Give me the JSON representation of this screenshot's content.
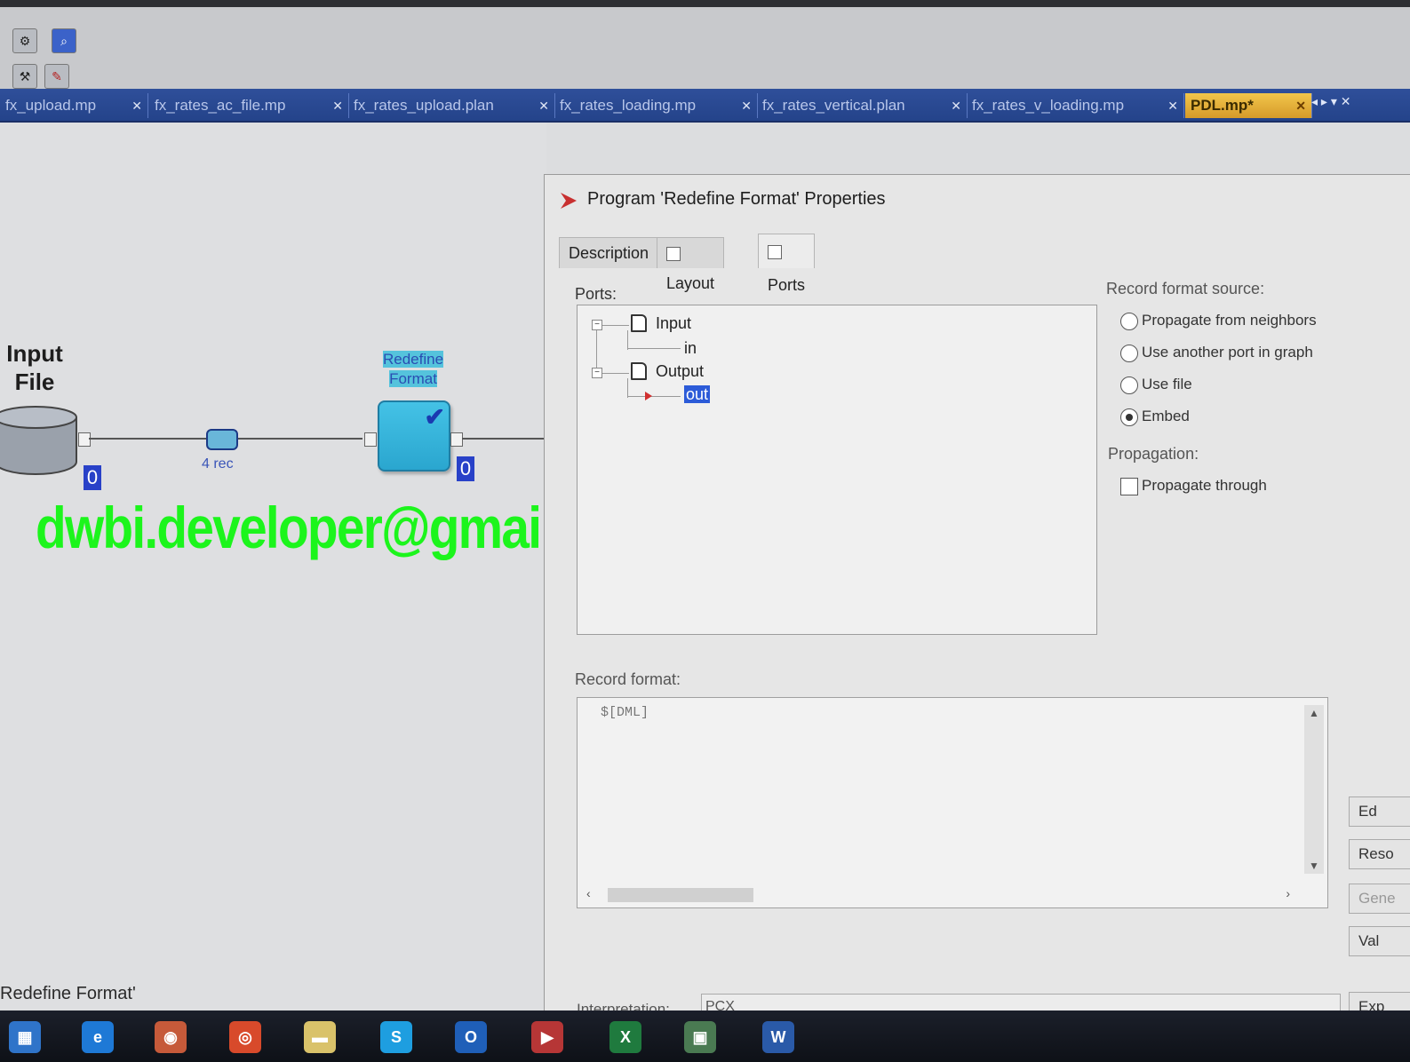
{
  "window": {
    "tabs": [
      {
        "label": "fx_upload.mp",
        "active": false
      },
      {
        "label": "fx_rates_ac_file.mp",
        "active": false
      },
      {
        "label": "fx_rates_upload.plan",
        "active": false
      },
      {
        "label": "fx_rates_loading.mp",
        "active": false
      },
      {
        "label": "fx_rates_vertical.plan",
        "active": false
      },
      {
        "label": "fx_rates_v_loading.mp",
        "active": false
      },
      {
        "label": "PDL.mp*",
        "active": true
      }
    ],
    "tab_close": "✕",
    "tab_nav": "◂ ▸ ▾ ✕"
  },
  "canvas": {
    "input_label_line1": "Input",
    "input_label_line2": "File",
    "input_count": "0",
    "flow_label": "4 rec",
    "component_label_line1": "Redefine",
    "component_label_line2": "Format",
    "component_count": "0",
    "watermark": "dwbi.developer@gmail.com",
    "status": "Redefine Format'"
  },
  "dialog": {
    "title": "Program 'Redefine Format' Properties",
    "tabs": [
      "Description",
      "Layout",
      "Ports"
    ],
    "ports_label": "Ports:",
    "tree": {
      "input": "Input",
      "input_port": "in",
      "output": "Output",
      "output_port": "out"
    },
    "record_source_label": "Record format source:",
    "record_source_options": [
      {
        "label": "Propagate from neighbors",
        "selected": false
      },
      {
        "label": "Use another port in graph",
        "selected": false
      },
      {
        "label": "Use file",
        "selected": false
      },
      {
        "label": "Embed",
        "selected": true
      }
    ],
    "propagation_label": "Propagation:",
    "propagate_through": "Propagate through",
    "record_format_label": "Record format:",
    "record_format_value": "$[DML]",
    "side_buttons": [
      "Ed",
      "Reso",
      "Gene",
      "Val"
    ],
    "interpretation_label": "Interpretation:",
    "interpretation_value": "PCX",
    "next_button": "Exp"
  },
  "taskbar": {
    "apps": [
      {
        "icon": "file-explorer-icon",
        "glyph": "▦",
        "color": "#2f74c9"
      },
      {
        "icon": "internet-explorer-icon",
        "glyph": "e",
        "color": "#1e79d6"
      },
      {
        "icon": "screen-capture-icon",
        "glyph": "◉",
        "color": "#c65a3a"
      },
      {
        "icon": "chrome-icon",
        "glyph": "◎",
        "color": "#d84a2b"
      },
      {
        "icon": "sticky-notes-icon",
        "glyph": "▬",
        "color": "#d9c26a"
      },
      {
        "icon": "skype-icon",
        "glyph": "S",
        "color": "#1e9ee0"
      },
      {
        "icon": "outlook-icon",
        "glyph": "O",
        "color": "#1f5fb8"
      },
      {
        "icon": "gde-app-icon",
        "glyph": "▶",
        "color": "#b63636"
      },
      {
        "icon": "excel-icon",
        "glyph": "X",
        "color": "#1f7a3e"
      },
      {
        "icon": "project-icon",
        "glyph": "▣",
        "color": "#4a7a52"
      },
      {
        "icon": "word-icon",
        "glyph": "W",
        "color": "#2a5aa8"
      }
    ]
  }
}
